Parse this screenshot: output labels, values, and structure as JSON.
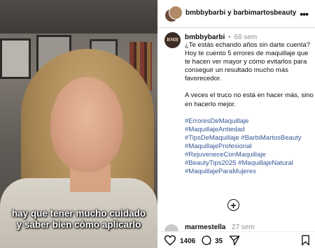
{
  "video": {
    "subtitle_line1": "hay que tener mucho cuidado",
    "subtitle_line2": "y saber bien cómo aplicarlo"
  },
  "header": {
    "title": "bmbbybarbi y barbimartosbeauty",
    "more_icon": "more-icon"
  },
  "post": {
    "logo_text": "BMB",
    "username": "bmbbybarbi",
    "time": "68 sem",
    "body": [
      "¿Te estás echando años sin darte cuenta?",
      "Hoy te cuento 5 errores de maquillaje que te hacen ver mayor y cómo evitarlos para conseguir un resultado mucho más favorecedor.",
      "A veces el truco no está en hacer más, sino en hacerlo mejor."
    ],
    "hashtags": [
      "#ErroresDeMaquillaje",
      "#MaquillajeAntiedad",
      "#TipsDeMaquillaje #BarbiMartosBeauty",
      "#MaquillajeProfesional",
      "#RejuveneceConMaquillaje",
      "#BeautyTips2025 #MaquillajeNatural",
      "#MaquillajeParaMujeres"
    ]
  },
  "comment": {
    "user": "marmestella",
    "time": "27 sem"
  },
  "actions": {
    "likes": "1406",
    "comments": "35"
  },
  "colors": {
    "link": "#385898",
    "text": "#111111",
    "muted": "#8e8e8e"
  }
}
